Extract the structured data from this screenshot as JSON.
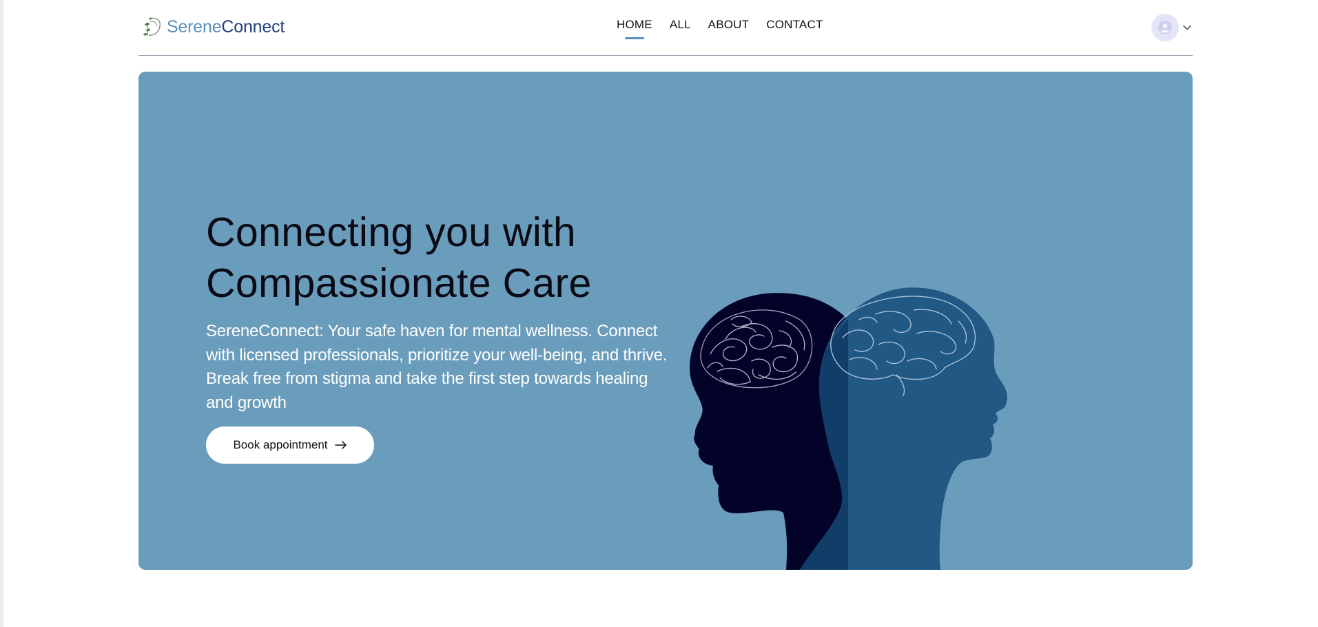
{
  "brand": {
    "name_part1": "Serene",
    "name_part2": "Connect",
    "color_light": "#5b8fb9",
    "color_dark": "#233f7a",
    "logo_icon": "leaf-vine-icon"
  },
  "nav": {
    "items": [
      {
        "label": "HOME",
        "active": true
      },
      {
        "label": "ALL",
        "active": false
      },
      {
        "label": "ABOUT",
        "active": false
      },
      {
        "label": "CONTACT",
        "active": false
      }
    ],
    "active_underline_color": "#5b8fb9"
  },
  "user_menu": {
    "avatar_icon": "user-avatar-icon",
    "dropdown_icon": "chevron-down-icon"
  },
  "hero": {
    "background_color": "#6a9cbc",
    "title_line1": "Connecting you with",
    "title_line2": "Compassionate Care",
    "description": "SereneConnect: Your safe haven for mental wellness. Connect with licensed professionals, prioritize your well-being, and thrive. Break free from stigma and take the first step towards healing and growth",
    "cta_label": "Book appointment",
    "cta_icon": "arrow-right-icon",
    "illustration": "two-heads-brain-silhouette"
  }
}
